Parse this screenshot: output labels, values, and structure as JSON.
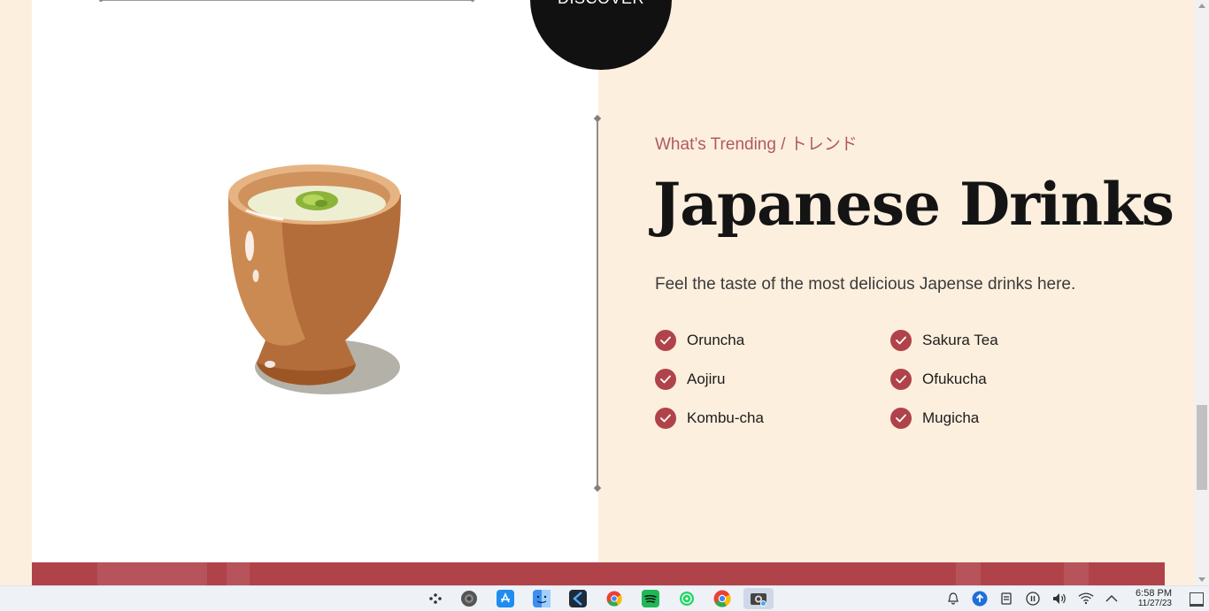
{
  "hero": {
    "discover_label": "DISCOVER"
  },
  "section": {
    "subtitle": "What’s Trending / トレンド",
    "title": "Japanese Drinks",
    "description": "Feel the taste of the most delicious Japense drinks here.",
    "drinks": [
      {
        "label": "Oruncha"
      },
      {
        "label": "Sakura Tea"
      },
      {
        "label": "Aojiru"
      },
      {
        "label": "Ofukucha"
      },
      {
        "label": "Kombu-cha"
      },
      {
        "label": "Mugicha"
      }
    ]
  },
  "colors": {
    "accent": "#b0434a",
    "cream_bg": "#fdefde",
    "subtitle": "#b05a5e",
    "heading": "#141414"
  },
  "taskbar": {
    "apps": [
      {
        "icon": "launcher-icon"
      },
      {
        "icon": "settings-icon"
      },
      {
        "icon": "app-store-icon"
      },
      {
        "icon": "finder-icon"
      },
      {
        "icon": "code-editor-icon"
      },
      {
        "icon": "chrome-icon"
      },
      {
        "icon": "spotify-icon"
      },
      {
        "icon": "whatsapp-icon"
      },
      {
        "icon": "chrome-icon"
      },
      {
        "icon": "screenshot-tool-icon",
        "active": true
      }
    ],
    "tray": [
      "alarm-icon",
      "upload-icon",
      "clipboard-icon",
      "pause-icon",
      "volume-icon",
      "wifi-icon",
      "chevron-up-icon"
    ],
    "time": "6:58 PM",
    "date": "11/27/23"
  }
}
